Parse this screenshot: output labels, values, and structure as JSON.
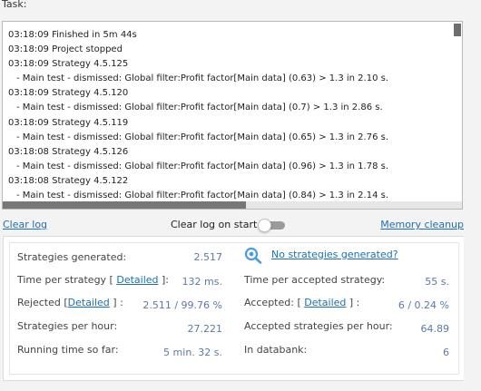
{
  "task_label": "Task:",
  "log_lines": [
    "03:18:09 Finished in 5m 44s",
    "03:18:09 Project stopped",
    "03:18:09 Strategy 4.5.125",
    "- Main test - dismissed: Global filter:Profit factor[Main data] (0.63) > 1.3 in 2.10 s.",
    "03:18:09 Strategy 4.5.120",
    "- Main test - dismissed: Global filter:Profit factor[Main data] (0.7) > 1.3 in 2.86 s.",
    "03:18:09 Strategy 4.5.119",
    "- Main test - dismissed: Global filter:Profit factor[Main data] (0.65) > 1.3 in 2.76 s.",
    "03:18:08 Strategy 4.5.126",
    "- Main test - dismissed: Global filter:Profit factor[Main data] (0.96) > 1.3 in 1.78 s.",
    "03:18:08 Strategy 4.5.122",
    "- Main test - dismissed: Global filter:Profit factor[Main data] (0.84) > 1.3 in 2.14 s."
  ],
  "controls": {
    "clear_log": "Clear log",
    "clear_log_on_start": "Clear log on start",
    "memory_cleanup": "Memory cleanup"
  },
  "stats": {
    "strategies_generated_label": "Strategies generated:",
    "strategies_generated_value": "2.517",
    "time_per_strategy_prefix": "Time per strategy [",
    "time_per_strategy_suffix": "]:",
    "time_per_strategy_value": "132 ms.",
    "rejected_prefix": "Rejected [",
    "rejected_suffix": "] :",
    "rejected_value": "2.511 / 99.76 %",
    "strategies_per_hour_label": "Strategies per hour:",
    "strategies_per_hour_value": "27.221",
    "running_time_label": "Running time so far:",
    "running_time_value": "5 min. 32 s.",
    "no_strategies_link": "No strategies generated?",
    "time_per_accepted_label": "Time per accepted strategy:",
    "time_per_accepted_value": "55 s.",
    "accepted_prefix": "Accepted: [",
    "accepted_suffix": "] :",
    "accepted_value": "6 / 0.24 %",
    "accepted_per_hour_label": "Accepted strategies per hour:",
    "accepted_per_hour_value": "64.89",
    "in_databank_label": "In databank:",
    "in_databank_value": "6",
    "detailed_link": "Detailed"
  }
}
